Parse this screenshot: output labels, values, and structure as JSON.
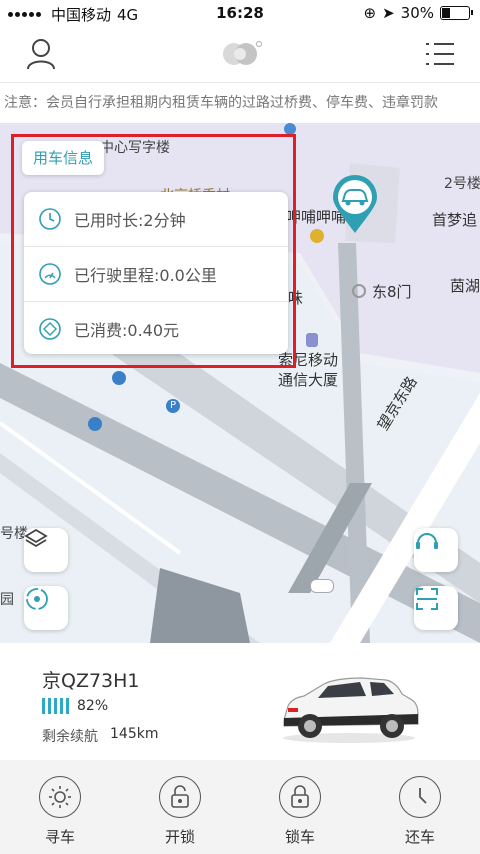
{
  "status_bar": {
    "carrier": "中国移动",
    "network": "4G",
    "time": "16:28",
    "battery_percent": "30%",
    "battery_level": 0.3
  },
  "notice": {
    "text": "注意：会员自行承担租期内租赁车辆的过路过桥费、停车费、违章罚款"
  },
  "map": {
    "labels": {
      "center_office": "中心写字楼",
      "building2": "2号楼",
      "restaurant": "呷哺呷哺",
      "shoumeng": "首梦追",
      "gate": "东8门",
      "yin": "茵湖",
      "flavor": "味",
      "sony": "索尼移动",
      "telecom": "通信大厦",
      "road": "望京东路",
      "building_left": "号楼",
      "park_left": "园",
      "beijing": "北京桥香村"
    }
  },
  "usage_info": {
    "tag": "用车信息",
    "rows": [
      {
        "icon": "clock-icon",
        "text": "已用时长:2分钟"
      },
      {
        "icon": "speedometer-icon",
        "text": "已行驶里程:0.0公里"
      },
      {
        "icon": "cost-diamond-icon",
        "text": "已消费:0.40元"
      }
    ]
  },
  "car": {
    "plate": "京QZ73H1",
    "battery": "82%",
    "battery_level": 0.82,
    "range_label": "剩余续航",
    "range_value": "145km"
  },
  "actions": [
    {
      "name": "find-car",
      "icon": "sun-icon",
      "label": "寻车"
    },
    {
      "name": "unlock",
      "icon": "unlock-icon",
      "label": "开锁"
    },
    {
      "name": "lock",
      "icon": "lock-icon",
      "label": "锁车"
    },
    {
      "name": "return",
      "icon": "clock-icon",
      "label": "还车"
    }
  ],
  "colors": {
    "accent": "#2f9fb3",
    "highlight_border": "#e01e2a"
  }
}
